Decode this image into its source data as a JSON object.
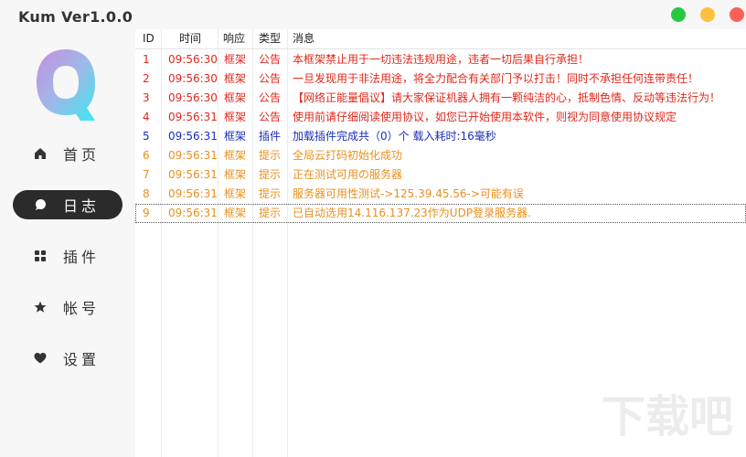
{
  "app": {
    "title": "Kum Ver1.0.0"
  },
  "window_controls": [
    {
      "name": "minimize",
      "color": "#28c840"
    },
    {
      "name": "maximize",
      "color": "#fdc13f"
    },
    {
      "name": "close",
      "color": "#fe5f57"
    }
  ],
  "logo": {
    "letter": "Q"
  },
  "sidebar": {
    "items": [
      {
        "label": "首页",
        "icon": "home-icon",
        "active": false
      },
      {
        "label": "日志",
        "icon": "chat-bubble-icon",
        "active": true
      },
      {
        "label": "插件",
        "icon": "grid-icon",
        "active": false
      },
      {
        "label": "帐号",
        "icon": "star-icon",
        "active": false
      },
      {
        "label": "设置",
        "icon": "heart-icon",
        "active": false
      }
    ]
  },
  "log_table": {
    "headers": {
      "id": "ID",
      "time": "时间",
      "response": "响应",
      "type": "类型",
      "message": "消息"
    },
    "rows": [
      {
        "id": "1",
        "time": "09:56:30",
        "response": "框架",
        "type": "公告",
        "message": "本框架禁止用于一切违法违规用途，违者一切后果自行承担！",
        "color": "red"
      },
      {
        "id": "2",
        "time": "09:56:30",
        "response": "框架",
        "type": "公告",
        "message": "一旦发现用于非法用途，将全力配合有关部门予以打击！同时不承担任何连带责任！",
        "color": "red"
      },
      {
        "id": "3",
        "time": "09:56:30",
        "response": "框架",
        "type": "公告",
        "message": "【网络正能量倡议】请大家保证机器人拥有一颗纯洁的心，抵制色情、反动等违法行为！",
        "color": "red"
      },
      {
        "id": "4",
        "time": "09:56:31",
        "response": "框架",
        "type": "公告",
        "message": "使用前请仔细阅读使用协议，如您已开始使用本软件，则视为同意使用协议规定",
        "color": "red"
      },
      {
        "id": "5",
        "time": "09:56:31",
        "response": "框架",
        "type": "插件",
        "message": "加载插件完成共（0）个 载入耗时:16毫秒",
        "color": "blue"
      },
      {
        "id": "6",
        "time": "09:56:31",
        "response": "框架",
        "type": "提示",
        "message": "全局云打码初始化成功",
        "color": "orange"
      },
      {
        "id": "7",
        "time": "09:56:31",
        "response": "框架",
        "type": "提示",
        "message": "正在测试可用の服务器",
        "color": "orange"
      },
      {
        "id": "8",
        "time": "09:56:31",
        "response": "框架",
        "type": "提示",
        "message": "服务器可用性测试->125.39.45.56->可能有误",
        "color": "orange"
      },
      {
        "id": "9",
        "time": "09:56:31",
        "response": "框架",
        "type": "提示",
        "message": "已自动选用14.116.137.23作为UDP登录服务器.",
        "color": "orange",
        "selected": true
      }
    ]
  },
  "colors": {
    "red": "#e0281b",
    "blue": "#1c2fb5",
    "orange": "#e8901e",
    "active_nav": "#2b2b2b"
  },
  "watermark": "下载吧"
}
